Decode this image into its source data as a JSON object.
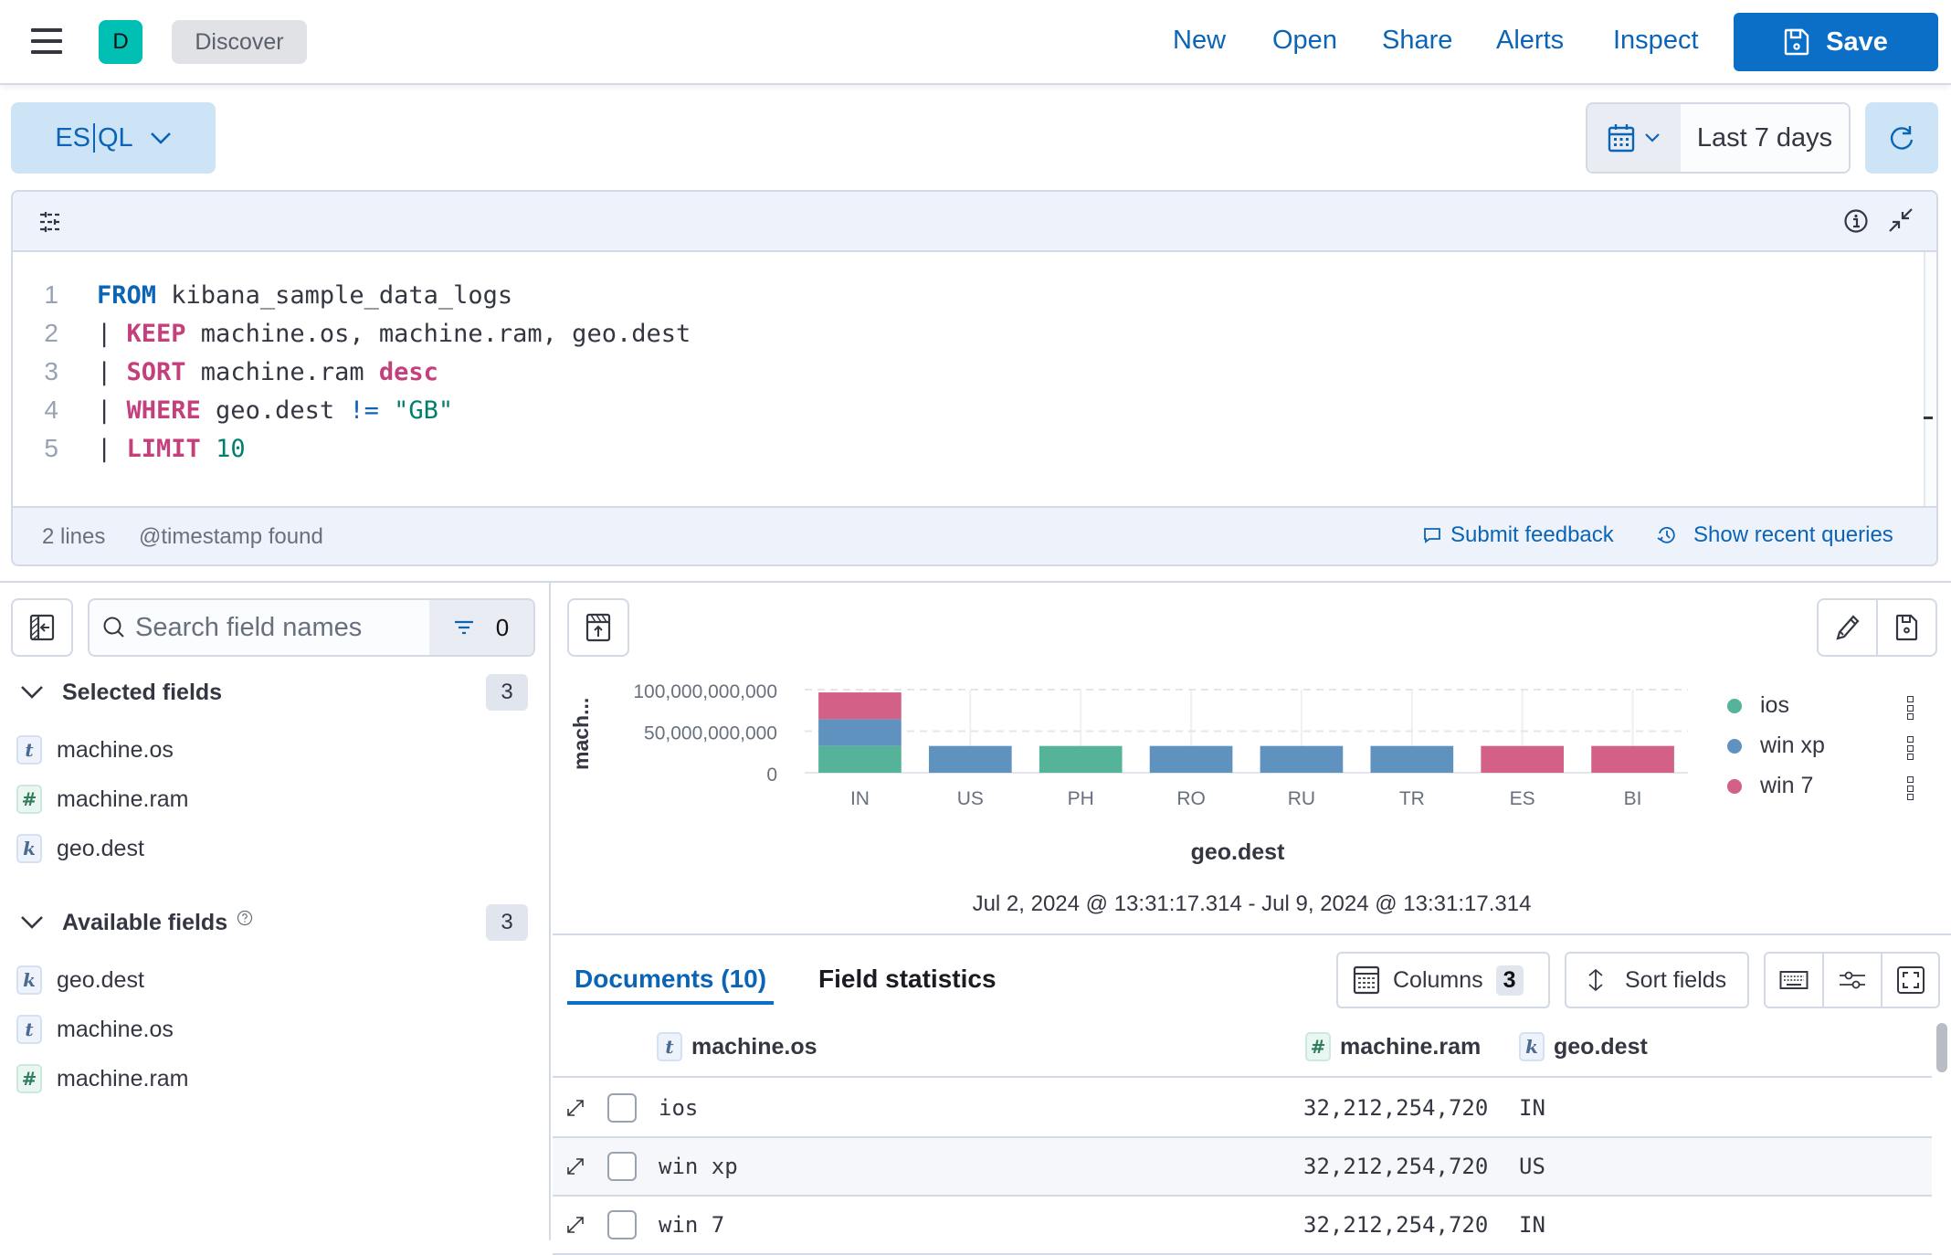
{
  "header": {
    "avatar_letter": "D",
    "breadcrumb": "Discover",
    "links": [
      "New",
      "Open",
      "Share",
      "Alerts",
      "Inspect"
    ],
    "save_label": "Save"
  },
  "query_bar": {
    "language_label_left": "ES",
    "language_label_right": "QL",
    "date_range_label": "Last 7 days"
  },
  "editor": {
    "lines": [
      {
        "num": "1",
        "tokens": [
          {
            "t": "FROM",
            "c": "kwb"
          },
          {
            "t": " kibana_sample_data_logs",
            "c": ""
          }
        ]
      },
      {
        "num": "2",
        "tokens": [
          {
            "t": "| ",
            "c": ""
          },
          {
            "t": "KEEP",
            "c": "kwp"
          },
          {
            "t": " machine.os, machine.ram, geo.dest",
            "c": ""
          }
        ]
      },
      {
        "num": "3",
        "tokens": [
          {
            "t": "| ",
            "c": ""
          },
          {
            "t": "SORT",
            "c": "kwp"
          },
          {
            "t": " machine.ram ",
            "c": ""
          },
          {
            "t": "desc",
            "c": "kwp"
          }
        ]
      },
      {
        "num": "4",
        "tokens": [
          {
            "t": "| ",
            "c": ""
          },
          {
            "t": "WHERE",
            "c": "kwp"
          },
          {
            "t": " geo.dest ",
            "c": ""
          },
          {
            "t": "!=",
            "c": "op"
          },
          {
            "t": " ",
            "c": ""
          },
          {
            "t": "\"GB\"",
            "c": "str"
          }
        ]
      },
      {
        "num": "5",
        "tokens": [
          {
            "t": "| ",
            "c": ""
          },
          {
            "t": "LIMIT",
            "c": "kwp"
          },
          {
            "t": " ",
            "c": ""
          },
          {
            "t": "10",
            "c": "num"
          }
        ]
      }
    ],
    "footer": {
      "line_count": "2 lines",
      "timestamp_status": "@timestamp found",
      "submit_feedback": "Submit feedback",
      "recent_queries": "Show recent queries"
    }
  },
  "sidebar": {
    "search_placeholder": "Search field names",
    "filter_count": "0",
    "selected": {
      "title": "Selected fields",
      "count": "3",
      "items": [
        {
          "type": "t",
          "name": "machine.os"
        },
        {
          "type": "n",
          "name": "machine.ram"
        },
        {
          "type": "k",
          "name": "geo.dest"
        }
      ]
    },
    "available": {
      "title": "Available fields",
      "count": "3",
      "items": [
        {
          "type": "k",
          "name": "geo.dest"
        },
        {
          "type": "t",
          "name": "machine.os"
        },
        {
          "type": "n",
          "name": "machine.ram"
        }
      ]
    }
  },
  "type_glyphs": {
    "t": "t",
    "n": "#",
    "k": "k"
  },
  "chart_data": {
    "type": "bar",
    "stacked": true,
    "title": "",
    "xlabel": "geo.dest",
    "ylabel": "mach...",
    "categories": [
      "IN",
      "US",
      "PH",
      "RO",
      "RU",
      "TR",
      "ES",
      "BI"
    ],
    "series": [
      {
        "name": "ios",
        "color": "#54b399",
        "values": [
          32212254720,
          0,
          32212254720,
          0,
          0,
          0,
          0,
          0
        ]
      },
      {
        "name": "win xp",
        "color": "#6092c0",
        "values": [
          32212254720,
          32212254720,
          0,
          32212254720,
          32212254720,
          32212254720,
          0,
          0
        ]
      },
      {
        "name": "win 7",
        "color": "#d36086",
        "values": [
          32212254720,
          0,
          0,
          0,
          0,
          0,
          32212254720,
          32212254720
        ]
      }
    ],
    "yticks": [
      0,
      50000000000,
      100000000000
    ],
    "ytick_labels": [
      "0",
      "50,000,000,000",
      "100,000,000,000"
    ],
    "ylim": [
      0,
      100000000000
    ],
    "grid": true,
    "legend": "right"
  },
  "chart_footer": {
    "time_range": "Jul 2, 2024 @ 13:31:17.314 - Jul 9, 2024 @ 13:31:17.314"
  },
  "results": {
    "tabs": [
      {
        "label": "Documents (10)",
        "active": true
      },
      {
        "label": "Field statistics",
        "active": false
      }
    ],
    "columns_label": "Columns",
    "columns_count": "3",
    "sort_label": "Sort fields",
    "headers": [
      {
        "type": "t",
        "name": "machine.os"
      },
      {
        "type": "n",
        "name": "machine.ram"
      },
      {
        "type": "k",
        "name": "geo.dest"
      }
    ],
    "rows": [
      {
        "os": "ios",
        "ram": "32,212,254,720",
        "dest": "IN"
      },
      {
        "os": "win xp",
        "ram": "32,212,254,720",
        "dest": "US"
      },
      {
        "os": "win 7",
        "ram": "32,212,254,720",
        "dest": "IN"
      }
    ]
  }
}
